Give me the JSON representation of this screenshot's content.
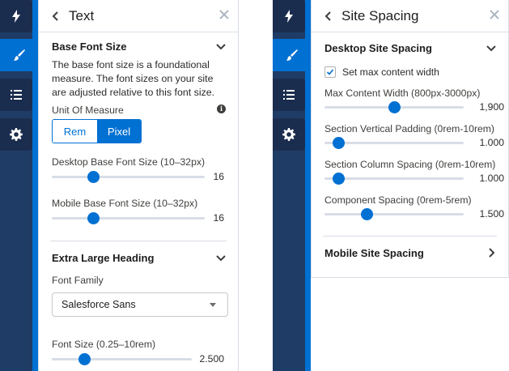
{
  "left": {
    "rail_icons": [
      "lightning-icon",
      "brush-icon",
      "list-icon",
      "gear-icon"
    ],
    "panel": {
      "title": "Text",
      "section1": {
        "title": "Base Font Size",
        "description": "The base font size is a foundational measure. The font sizes on your site are adjusted relative to this font size.",
        "unit_label": "Unit Of Measure",
        "unit_options": [
          "Rem",
          "Pixel"
        ],
        "unit_selected": "Pixel",
        "desktop_label": "Desktop Base Font Size (10–32px)",
        "desktop_value": "16",
        "desktop_fraction": 0.27,
        "mobile_label": "Mobile Base Font Size (10–32px)",
        "mobile_value": "16",
        "mobile_fraction": 0.27
      },
      "section2": {
        "title": "Extra Large Heading",
        "font_family_label": "Font Family",
        "font_family_value": "Salesforce Sans",
        "font_size_label": "Font Size (0.25–10rem)",
        "font_size_value": "2.500",
        "font_size_fraction": 0.23
      }
    }
  },
  "right": {
    "rail_icons": [
      "lightning-icon",
      "brush-icon",
      "list-icon",
      "gear-icon"
    ],
    "panel": {
      "title": "Site Spacing",
      "desktop": {
        "title": "Desktop Site Spacing",
        "checkbox_label": "Set max content width",
        "checkbox_checked": true,
        "sliders": [
          {
            "label": "Max Content Width (800px-3000px)",
            "value": "1,900",
            "fraction": 0.5
          },
          {
            "label": "Section Vertical Padding (0rem-10rem)",
            "value": "1.000",
            "fraction": 0.1
          },
          {
            "label": "Section Column Spacing (0rem-10rem)",
            "value": "1.000",
            "fraction": 0.1
          },
          {
            "label": "Component Spacing (0rem-5rem)",
            "value": "1.500",
            "fraction": 0.3
          }
        ]
      },
      "mobile": {
        "title": "Mobile Site Spacing"
      }
    }
  },
  "colors": {
    "accent": "#0070d2",
    "rail": "#1f3c66",
    "rail_button": "#1b2d4f"
  }
}
